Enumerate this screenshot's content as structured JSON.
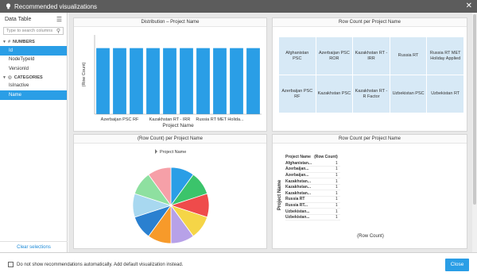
{
  "window": {
    "title": "Recommended visualizations",
    "close_glyph": "✕"
  },
  "sidebar": {
    "header": "Data Table",
    "search_placeholder": "Type to search columns",
    "groups": [
      {
        "label": "NUMBERS",
        "items": [
          "Id",
          "NodeTypeId",
          "VersionId"
        ]
      },
      {
        "label": "CATEGORIES",
        "items": [
          "IsInactive",
          "Name"
        ]
      }
    ],
    "selected_items": [
      "Id",
      "Name"
    ],
    "footer_link": "Clear selections"
  },
  "chart1": {
    "title": "Distribution – Project Name",
    "chart_data": {
      "type": "bar",
      "categories": [
        "Afghanistan PSC",
        "Azerbaijan PSC RF",
        "Azerbaijan PSC ROR",
        "Kazakhstan PSC",
        "Kazakhstan RT - IRR",
        "Kazakhstan RT - R Factor",
        "Russia RT",
        "Russia RT MET Holiday Applied",
        "Uzbekistan PSC",
        "Uzbekistan RT"
      ],
      "values": [
        1,
        1,
        1,
        1,
        1,
        1,
        1,
        1,
        1,
        1
      ],
      "tick_labels": [
        "Azerbaijan PSC RF",
        "Kazakhstan RT - IRR",
        "Russia RT MET Holida..."
      ],
      "xlabel": "Project Name",
      "ylabel": "(Row Count)",
      "ylim": [
        0,
        1.2
      ],
      "color": "#2a9ee6"
    }
  },
  "chart2": {
    "title": "Row Count per Project Name",
    "cells": [
      "Afghanistan PSC",
      "Azerbaijan PSC ROR",
      "Kazakhstan RT - IRR",
      "Russia RT",
      "Russia RT MET Holiday Applied",
      "Azerbaijan PSC RF",
      "Kazakhstan PSC",
      "Kazakhstan RT - R Factor",
      "Uzbekistan PSC",
      "Uzbekistan RT"
    ]
  },
  "chart3": {
    "title": "(Row Count) per Project Name",
    "legend_label": "Project Name",
    "chart_data": {
      "type": "pie",
      "slices": [
        {
          "value": 1,
          "color": "#2a9ee6"
        },
        {
          "value": 1,
          "color": "#3bc46b"
        },
        {
          "value": 1,
          "color": "#ef4b4b"
        },
        {
          "value": 1,
          "color": "#f5d547"
        },
        {
          "value": 1,
          "color": "#b7a1e8"
        },
        {
          "value": 1,
          "color": "#f79a2a"
        },
        {
          "value": 1,
          "color": "#2a80d0"
        },
        {
          "value": 1,
          "color": "#a8d8f0"
        },
        {
          "value": 1,
          "color": "#8ee0a0"
        },
        {
          "value": 1,
          "color": "#f6a0a8"
        }
      ]
    }
  },
  "chart4": {
    "title": "Row Count per Project Name",
    "col1": "Project Name",
    "col2": "(Row Count)",
    "rows": [
      {
        "name": "Afghanistan...",
        "value": "1"
      },
      {
        "name": "Azerbaijan...",
        "value": "1"
      },
      {
        "name": "Azerbaijan...",
        "value": "1"
      },
      {
        "name": "Kazakhstan...",
        "value": "1"
      },
      {
        "name": "Kazakhstan...",
        "value": "1"
      },
      {
        "name": "Kazakhstan...",
        "value": "1"
      },
      {
        "name": "Russia RT",
        "value": "1"
      },
      {
        "name": "Russia RT...",
        "value": "1"
      },
      {
        "name": "Uzbekistan...",
        "value": "1"
      },
      {
        "name": "Uzbekistan...",
        "value": "1"
      }
    ],
    "ylabel": "Project Name",
    "xlabel": "(Row Count)"
  },
  "footer": {
    "checkbox_label": "Do not show recommendations automatically. Add default visualization instead.",
    "close_button": "Close"
  }
}
